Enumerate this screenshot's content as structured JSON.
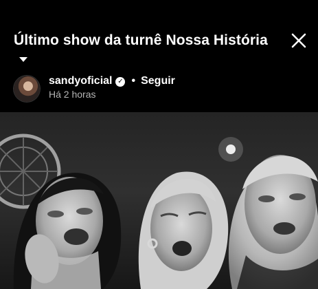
{
  "post": {
    "title": "Último show da turnê Nossa História",
    "title_caret_icon": "chevron-down-icon",
    "close_icon": "close-icon",
    "owner": {
      "username": "sandyoficial",
      "verified_icon": "verified-badge-icon",
      "separator": "•",
      "follow_label": "Seguir",
      "timestamp": "Há 2 horas"
    },
    "media": {
      "type": "black-and-white concert photo"
    }
  },
  "colors": {
    "background": "#000000",
    "text": "#ffffff",
    "muted_text": "#b5b5b5"
  }
}
